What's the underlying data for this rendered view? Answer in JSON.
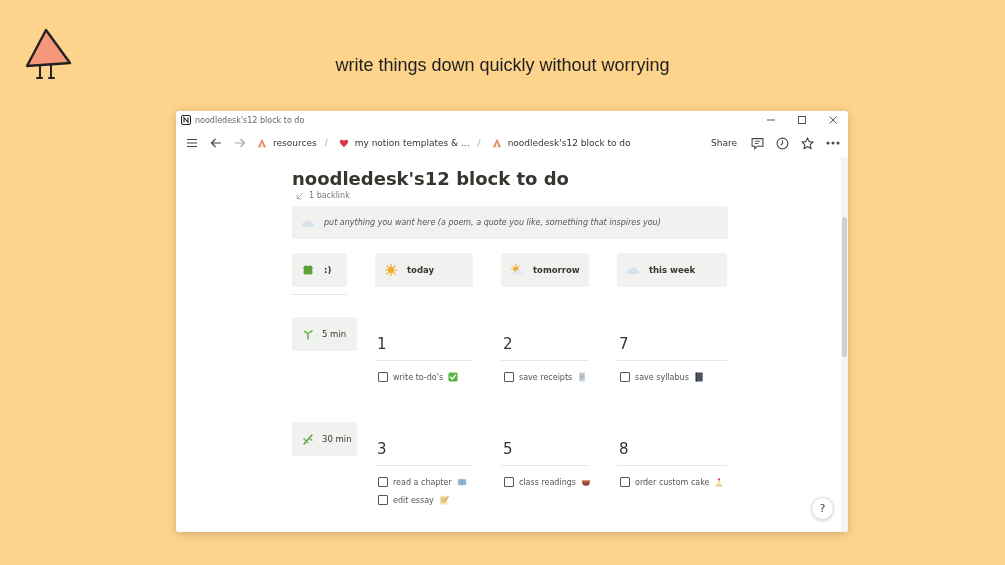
{
  "header": {
    "caption": "write things down quickly without worrying"
  },
  "window": {
    "title": "noodledesk's12 block to do"
  },
  "breadcrumbs": [
    {
      "label": "resources"
    },
    {
      "separator": "/",
      "label": "my notion templates & ..."
    },
    {
      "separator": "/",
      "label": "noodledesk's12 block to do"
    }
  ],
  "toolbar": {
    "share": "Share"
  },
  "page": {
    "title": "noodledesk's12 block to do",
    "backlinks": "1 backlink",
    "callout": "put anything you want here (a poem, a quote you like, something that inspires you)",
    "headers": [
      {
        "label": ":)"
      },
      {
        "label": "today"
      },
      {
        "label": "tomorrow"
      },
      {
        "label": "this week"
      }
    ],
    "blocks": [
      {
        "label": "5 min",
        "columns": [
          {
            "number": "1",
            "tasks": [
              {
                "text": "write to-do's",
                "checked": false
              }
            ]
          },
          {
            "number": "2",
            "tasks": [
              {
                "text": "save receipts",
                "checked": false
              }
            ]
          },
          {
            "number": "7",
            "tasks": [
              {
                "text": "save syllabus",
                "checked": false
              }
            ]
          }
        ]
      },
      {
        "label": "30 min",
        "columns": [
          {
            "number": "3",
            "tasks": [
              {
                "text": "read a chapter",
                "checked": false
              },
              {
                "text": "edit essay",
                "checked": false
              }
            ]
          },
          {
            "number": "5",
            "tasks": [
              {
                "text": "class readings",
                "checked": false
              }
            ]
          },
          {
            "number": "8",
            "tasks": [
              {
                "text": "order custom cake",
                "checked": false
              }
            ]
          }
        ]
      }
    ]
  },
  "help": "?"
}
